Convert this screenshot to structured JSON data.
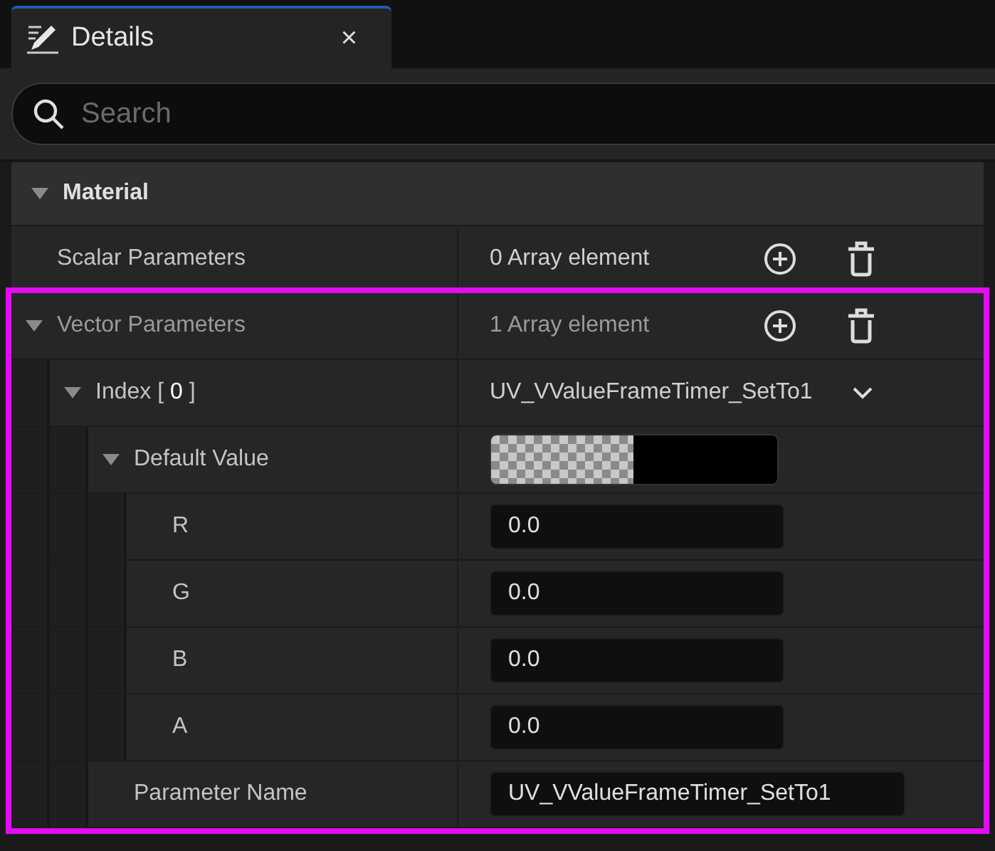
{
  "tab": {
    "title": "Details",
    "close": "×",
    "selected": true
  },
  "search": {
    "placeholder": "Search"
  },
  "section": {
    "title": "Material",
    "expanded": true
  },
  "properties": [
    {
      "name": "Scalar Parameters",
      "kind": "array",
      "value": "0 Array element"
    },
    {
      "name": "Vector Parameters",
      "kind": "array",
      "value": "1 Array element",
      "expanded": true,
      "highlighted": true,
      "children": [
        {
          "name": "Index [ **0** ]",
          "kind": "dropdown",
          "value": "UV_VValueFrameTimer_SetTo1",
          "expanded": true,
          "children": [
            {
              "name": "Default Value",
              "kind": "color",
              "expanded": true,
              "children": [
                {
                  "name": "R",
                  "kind": "number",
                  "value": "0.0"
                },
                {
                  "name": "G",
                  "kind": "number",
                  "value": "0.0"
                },
                {
                  "name": "B",
                  "kind": "number",
                  "value": "0.0"
                },
                {
                  "name": "A",
                  "kind": "number",
                  "value": "0.0"
                }
              ]
            },
            {
              "name": "Parameter Name",
              "kind": "text",
              "value": "UV_VValueFrameTimer_SetTo1"
            }
          ]
        }
      ]
    }
  ]
}
